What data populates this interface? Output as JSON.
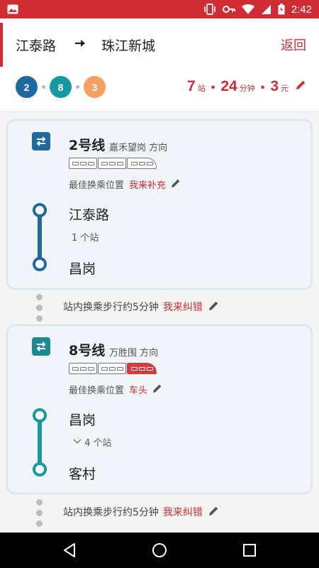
{
  "status_bar": {
    "time": "2:42"
  },
  "route": {
    "from": "江泰路",
    "to": "珠江新城",
    "back_label": "返回"
  },
  "lines_used": [
    {
      "label": "2",
      "color": "#1d6aa1"
    },
    {
      "label": "8",
      "color": "#159aa3"
    },
    {
      "label": "3",
      "color": "#f5a062"
    }
  ],
  "summary": {
    "stations": "7",
    "stations_unit": "站",
    "minutes": "24",
    "minutes_unit": "分钟",
    "fare": "3",
    "fare_unit": "元"
  },
  "segments": [
    {
      "line_name": "2号线",
      "direction": "嘉禾望岗 方向",
      "line_color": "#1d6aa1",
      "icon_color": "#1d6aa1",
      "best_position_label": "最佳换乘位置",
      "best_position_value": "我来补充",
      "from_station": "江泰路",
      "stops": "1 个站",
      "to_station": "昌岗"
    },
    {
      "line_name": "8号线",
      "direction": "万胜围 方向",
      "line_color": "#159aa3",
      "icon_color": "#1b8a92",
      "best_position_label": "最佳换乘位置",
      "best_position_value": "车头",
      "from_station": "昌岗",
      "stops": "4 个站",
      "to_station": "客村"
    }
  ],
  "transfers": [
    {
      "text": "站内换乘步行约5分钟",
      "action": "我来纠错"
    },
    {
      "text": "站内换乘步行约5分钟",
      "action": "我来纠错"
    }
  ]
}
